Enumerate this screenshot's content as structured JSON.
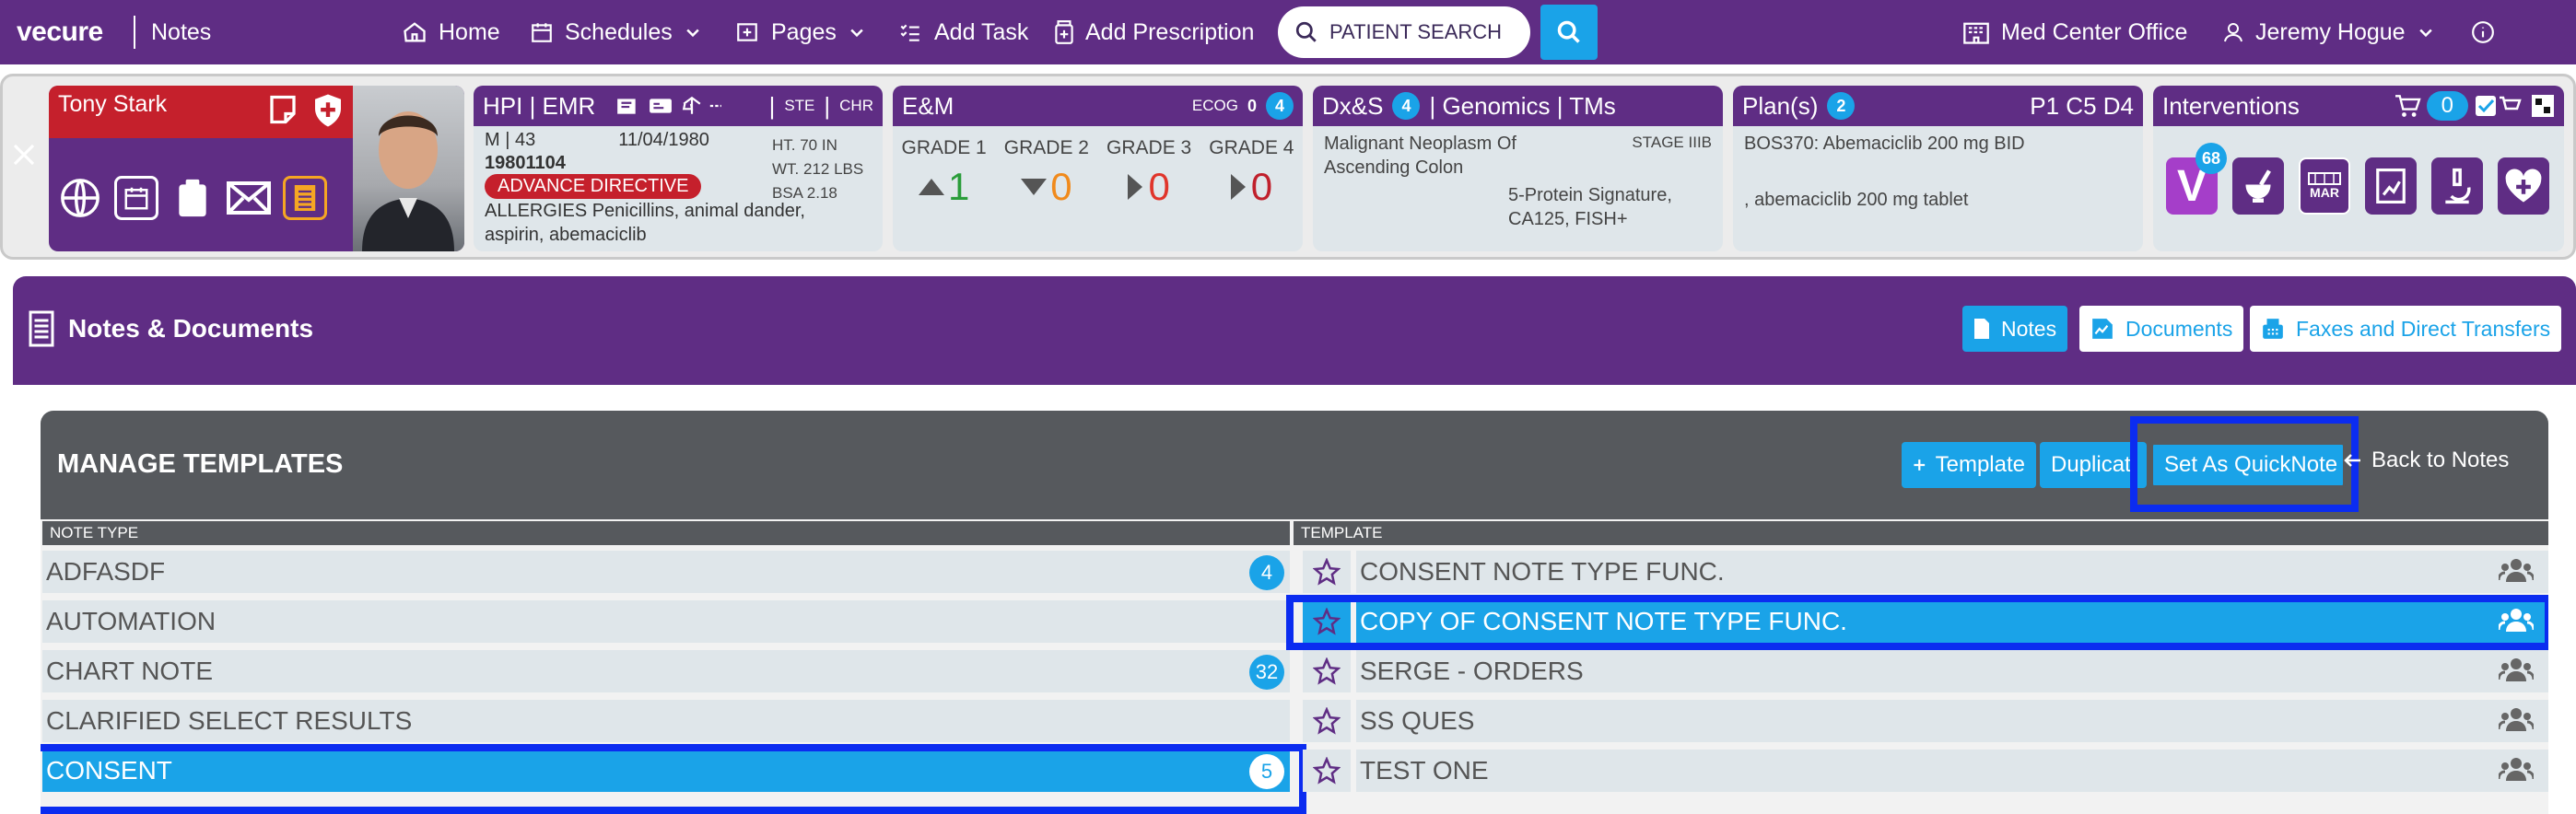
{
  "topnav": {
    "brand": "vecure",
    "section": "Notes",
    "items": [
      {
        "label": "Home",
        "icon": "home-icon"
      },
      {
        "label": "Schedules",
        "icon": "calendar-icon"
      },
      {
        "label": "Pages",
        "icon": "pages-icon"
      },
      {
        "label": "Add Task",
        "icon": "task-list-icon"
      },
      {
        "label": "Add Prescription",
        "icon": "prescription-icon"
      }
    ],
    "search_placeholder": "PATIENT SEARCH",
    "office": "Med Center Office",
    "user": "Jeremy Hogue"
  },
  "patient": {
    "name": "Tony Stark",
    "hpi": {
      "title": "HPI | EMR",
      "tags": [
        "STE",
        "CHR"
      ],
      "sex_age": "M | 43",
      "dob": "11/04/1980",
      "mrn": "19801104",
      "directive": "ADVANCE DIRECTIVE",
      "allergies": "ALLERGIES Penicillins, animal dander, aspirin, abemaciclib",
      "ht": "HT. 70 IN",
      "wt": "WT. 212 LBS",
      "bsa": "BSA 2.18"
    },
    "em": {
      "title": "E&M",
      "ecog_label": "ECOG",
      "ecog_value": "0",
      "badge": "4",
      "grades": [
        {
          "label": "GRADE 1",
          "value": "1",
          "color": "#2a9d3a"
        },
        {
          "label": "GRADE 2",
          "value": "0",
          "color": "#f08a1c"
        },
        {
          "label": "GRADE 3",
          "value": "0",
          "color": "#e0352b"
        },
        {
          "label": "GRADE 4",
          "value": "0",
          "color": "#c0202c"
        }
      ]
    },
    "dx": {
      "title_a": "Dx&S",
      "badge": "4",
      "title_b": "| Genomics | TMs",
      "diagnosis": "Malignant Neoplasm Of Ascending Colon",
      "stage": "STAGE IIIB",
      "genomics": "5-Protein Signature, CA125, FISH+"
    },
    "plan": {
      "title": "Plan(s)",
      "badge": "2",
      "cycle": "P1 C5 D4",
      "line1": "BOS370: Abemaciclib 200 mg BID",
      "line2": ", abemaciclib 200 mg tablet"
    },
    "interventions": {
      "title": "Interventions",
      "cart_count": "0",
      "v_badge": "68",
      "v_label": "V",
      "mar_label": "MAR"
    }
  },
  "notes": {
    "title": "Notes & Documents",
    "tabs": [
      "Notes",
      "Documents",
      "Faxes and Direct Transfers"
    ],
    "manage": {
      "title": "MANAGE TEMPLATES",
      "buttons": {
        "template": "Template",
        "duplicate": "Duplicat",
        "quicknote": "Set As QuickNote",
        "back": "Back to Notes"
      },
      "col_note_type": "NOTE TYPE",
      "col_template": "TEMPLATE",
      "note_types": [
        {
          "name": "ADFASDF",
          "count": "4"
        },
        {
          "name": "AUTOMATION",
          "count": ""
        },
        {
          "name": "CHART NOTE",
          "count": "32"
        },
        {
          "name": "CLARIFIED SELECT RESULTS",
          "count": ""
        },
        {
          "name": "CONSENT",
          "count": "5"
        }
      ],
      "templates": [
        "CONSENT NOTE TYPE FUNC.",
        "COPY OF CONSENT NOTE TYPE FUNC.",
        "SERGE - ORDERS",
        "SS QUES",
        "TEST ONE"
      ]
    }
  },
  "colors": {
    "purple": "#5f2d84",
    "blue": "#1aa3e8",
    "highlight": "#0b2cf0",
    "red": "#c5202c"
  }
}
